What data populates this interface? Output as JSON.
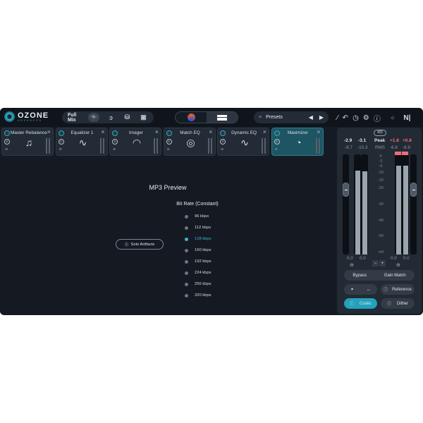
{
  "app": {
    "logo": "OZONE",
    "edition": "ADVANCED"
  },
  "top": {
    "full_mix": "Full Mix",
    "presets": "Presets",
    "icons": [
      "waveform-icon",
      "ear-icon",
      "drum-icon",
      "instrument-icon"
    ],
    "tools": [
      "pen-icon",
      "undo-icon",
      "history-icon",
      "gear-icon",
      "help-icon",
      "link-icon",
      "ni-logo"
    ]
  },
  "modules": [
    {
      "name": "Master Rebalance",
      "glyph": "♫"
    },
    {
      "name": "Equalizer 1",
      "glyph": "∿"
    },
    {
      "name": "Imager",
      "glyph": "◠"
    },
    {
      "name": "Match EQ",
      "glyph": "◎"
    },
    {
      "name": "Dynamic EQ",
      "glyph": "∿"
    },
    {
      "name": "Maximizer",
      "glyph": "◔",
      "active": true
    }
  ],
  "main": {
    "title": "MP3 Preview",
    "bitrate_label": "Bit Rate (Constant)",
    "solo_label": "Solo Artifacts",
    "rates": [
      "96 kbps",
      "112 kbps",
      "128 kbps",
      "160 kbps",
      "192 kbps",
      "224 kbps",
      "256 kbps",
      "320 kbps"
    ],
    "selected_rate": "128 kbps"
  },
  "meters": {
    "io": "I/O",
    "in_peak": [
      "-2.9",
      "-3.1"
    ],
    "in_rms": [
      "-9.7",
      "-10.3"
    ],
    "peak": "Peak",
    "rms": "RMS",
    "out_peak": [
      "+1.8",
      "+0.8"
    ],
    "out_rms": [
      "-6.8",
      "-6.9"
    ],
    "scale": [
      "0",
      "-3",
      "-6",
      "-10",
      "-15",
      "-20",
      "-30",
      "-40",
      "-50",
      "-Inf"
    ],
    "in_gain": [
      "0.0",
      "0.0"
    ],
    "out_gain": [
      "0.0",
      "0.0"
    ],
    "in_levels_db": [
      -9.7,
      -10.3
    ],
    "out_levels_db": [
      -6.8,
      -6.9
    ]
  },
  "buttons": {
    "bypass": "Bypass",
    "gain_match": "Gain Match",
    "reference": "Reference",
    "codec": "Codec",
    "dither": "Dither",
    "minus": "−",
    "plus": "+"
  },
  "colors": {
    "accent": "#3ab6d4",
    "clip": "#f06c78"
  }
}
